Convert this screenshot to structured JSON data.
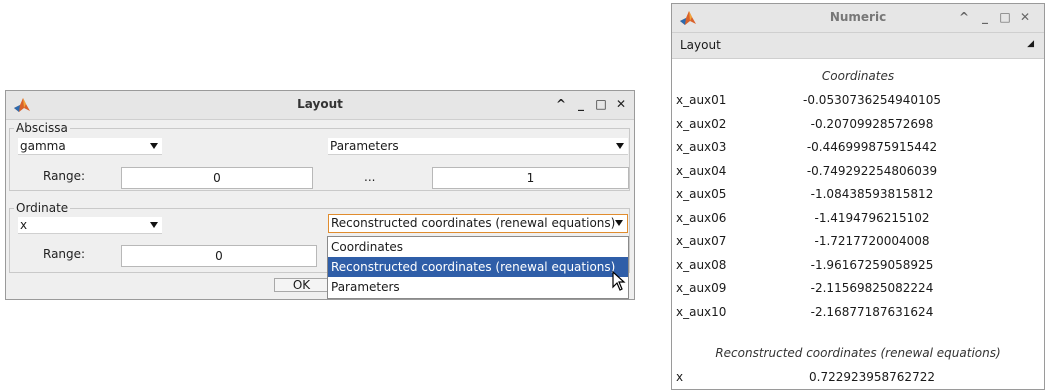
{
  "layout_window": {
    "title": "Layout",
    "abscissa": {
      "label": "Abscissa",
      "variable": "gamma",
      "type": "Parameters",
      "range_label": "Range:",
      "range_min": "0",
      "ellipsis": "...",
      "range_max": "1"
    },
    "ordinate": {
      "label": "Ordinate",
      "variable": "x",
      "type": "Reconstructed coordinates (renewal equations)",
      "range_label": "Range:",
      "range_min": "0"
    },
    "dropdown_options": [
      "Coordinates",
      "Reconstructed coordinates (renewal equations)",
      "Parameters"
    ],
    "dropdown_selected_index": 1,
    "ok_label": "OK"
  },
  "numeric_window": {
    "title": "Numeric",
    "menu_label": "Layout",
    "sections": [
      {
        "title": "Coordinates",
        "rows": [
          {
            "name": "x_aux01",
            "value": "-0.0530736254940105"
          },
          {
            "name": "x_aux02",
            "value": "-0.20709928572698"
          },
          {
            "name": "x_aux03",
            "value": "-0.446999875915442"
          },
          {
            "name": "x_aux04",
            "value": "-0.749292254806039"
          },
          {
            "name": "x_aux05",
            "value": "-1.08438593815812"
          },
          {
            "name": "x_aux06",
            "value": "-1.4194796215102"
          },
          {
            "name": "x_aux07",
            "value": "-1.7217720004008"
          },
          {
            "name": "x_aux08",
            "value": "-1.96167259058925"
          },
          {
            "name": "x_aux09",
            "value": "-2.11569825082224"
          },
          {
            "name": "x_aux10",
            "value": "-2.16877187631624"
          }
        ]
      },
      {
        "title": "Reconstructed coordinates (renewal equations)",
        "rows": [
          {
            "name": "x",
            "value": "0.722923958762722"
          }
        ]
      }
    ]
  },
  "icons": {
    "app": "matlab-logo-icon",
    "minimize": "minimize-icon",
    "maximize": "maximize-icon",
    "close": "close-icon",
    "collapse": "chevron-up-icon"
  },
  "colors": {
    "selection": "#2f5ea8",
    "focus_border": "#e08c2e"
  }
}
